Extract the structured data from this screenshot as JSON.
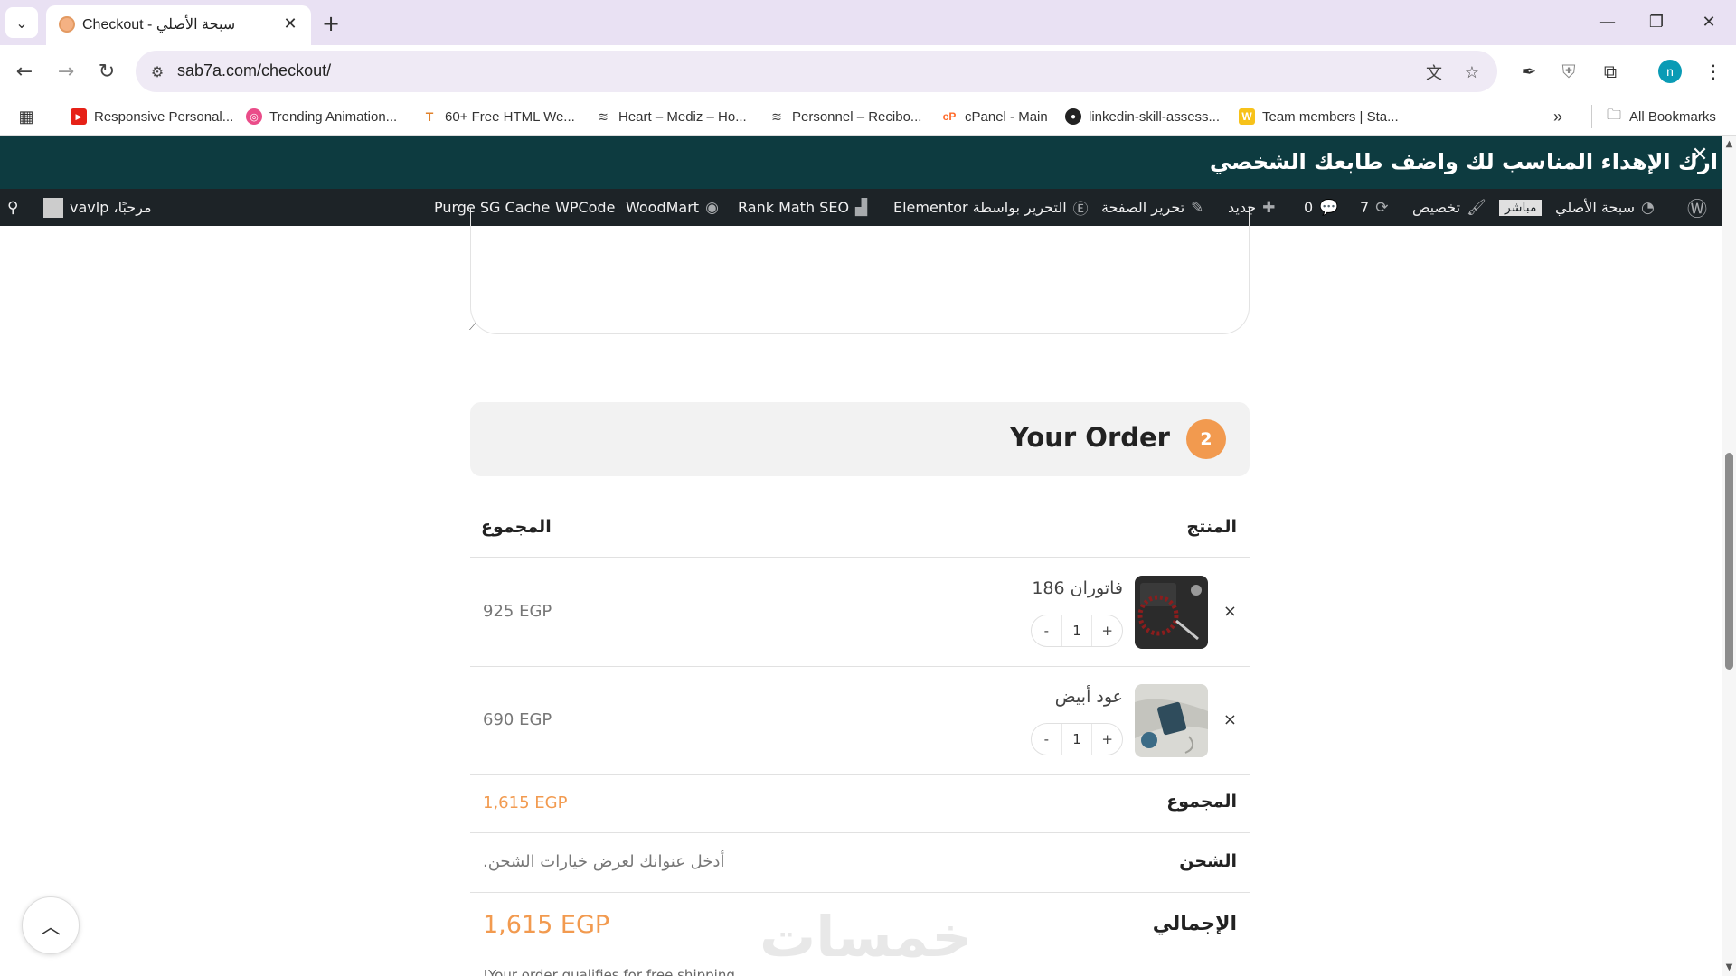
{
  "browser": {
    "tab_title": "Checkout - سبحة الأصلي",
    "url": "sab7a.com/checkout/",
    "profile_initial": "n",
    "icons": {
      "tab_list": "chevron-down-icon",
      "close": "close-icon",
      "new_tab": "plus-icon",
      "back": "arrow-left-icon",
      "forward": "arrow-right-icon",
      "reload": "reload-icon",
      "site_info": "tune-icon",
      "translate": "translate-icon",
      "star": "star-icon",
      "pen": "pen-icon",
      "shield": "shield-icon",
      "extensions": "puzzle-icon",
      "menu": "kebab-icon"
    }
  },
  "bookmarks": {
    "items": [
      {
        "label": "Responsive Personal...",
        "icon": "youtube-icon"
      },
      {
        "label": "Trending Animation...",
        "icon": "dribbble-icon"
      },
      {
        "label": "60+ Free HTML We...",
        "icon": "t-icon"
      },
      {
        "label": "Heart – Mediz – Ho...",
        "icon": "stack-icon"
      },
      {
        "label": "Personnel – Recibo...",
        "icon": "stack-icon"
      },
      {
        "label": "cPanel - Main",
        "icon": "cpanel-icon"
      },
      {
        "label": "linkedin-skill-assess...",
        "icon": "github-icon"
      },
      {
        "label": "Team members | Sta...",
        "icon": "w-icon"
      }
    ],
    "overflow": "»",
    "all_bookmarks": "All Bookmarks"
  },
  "site": {
    "promo_text": "ارك الإهداء المناسب لك واضف طابعك الشخصي",
    "admin_bar": {
      "site_name": "سبحة الأصلي",
      "live_badge": "مباشر",
      "customize": "تخصيص",
      "updates": "7",
      "comments": "0",
      "new": "جديد",
      "edit_page": "تحرير الصفحة",
      "elementor": "التحرير بواسطة Elementor",
      "rank_math": "Rank Math SEO",
      "woodmart": "WoodMart",
      "wpcode": "WPCode",
      "purge": "Purge SG Cache",
      "greeting": "مرحبًا، vavlp"
    }
  },
  "order": {
    "step_number": "2",
    "title": "Your Order",
    "col_product": "المنتج",
    "col_total": "المجموع",
    "items": [
      {
        "name": "فاتوران 186",
        "qty": "1",
        "price": "925 EGP",
        "plus": "+",
        "minus": "-"
      },
      {
        "name": "عود أبيض",
        "qty": "1",
        "price": "690 EGP",
        "plus": "+",
        "minus": "-"
      }
    ],
    "subtotal_label": "المجموع",
    "subtotal_value": "1,615 EGP",
    "shipping_label": "الشحن",
    "shipping_value": "أدخل عنوانك لعرض خيارات الشحن.",
    "total_label": "الإجمالي",
    "total_value": "1,615 EGP",
    "free_shipping_note": "!Your order qualifies for free shipping",
    "remove_symbol": "×"
  },
  "watermark_text": "خمسات",
  "colors": {
    "accent": "#f29a4f",
    "promo_bg": "#0d3b40",
    "admin_bar_bg": "#1d2327"
  }
}
